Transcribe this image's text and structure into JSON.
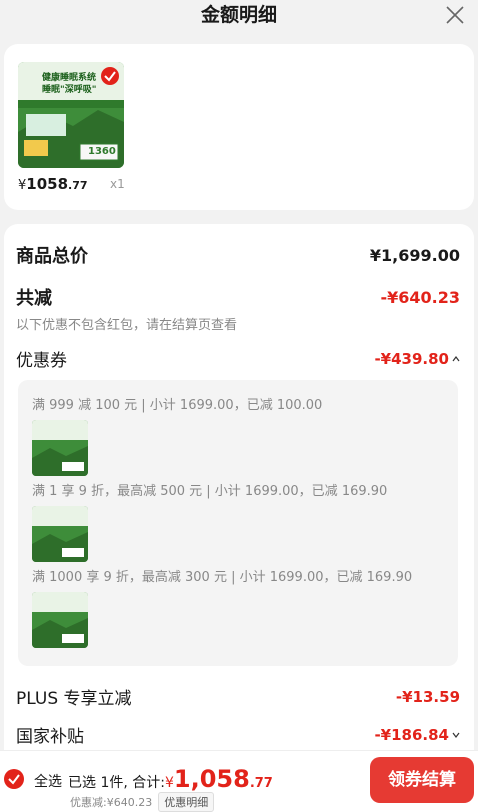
{
  "header": {
    "title": "金额明细"
  },
  "product": {
    "price_yen": "¥",
    "price_int": "1058",
    "price_dec": ".77",
    "qty": "x1",
    "thumb_text": {
      "line1": "健康睡眠系统",
      "line2": "睡眠\"深呼吸\"",
      "promo": "1360"
    }
  },
  "detail": {
    "total_label": "商品总价",
    "total_value": "¥1,699.00",
    "reduce_label": "共减",
    "reduce_value": "-¥640.23",
    "reduce_note": "以下优惠不包含红包，请在结算页查看",
    "coupon_label": "优惠券",
    "coupon_value": "-¥439.80",
    "coupon_items": [
      {
        "text": "满 999 减 100 元 | 小计 1699.00，已减 100.00"
      },
      {
        "text": "满 1 享 9 折，最高减 500 元 | 小计 1699.00，已减 169.90"
      },
      {
        "text": "满 1000 享 9 折，最高减 300 元 | 小计 1699.00，已减 169.90"
      }
    ],
    "plus_label": "PLUS 专享立减",
    "plus_value": "-¥13.59",
    "subsidy_label": "国家补贴",
    "subsidy_value": "-¥186.84"
  },
  "bottom": {
    "select_all": "全选",
    "summary_prefix": "已选 1件, 合计:",
    "total_yen": "¥",
    "total_int": "1,058",
    "total_dec": ".77",
    "saving": "优惠减:¥640.23",
    "saving_tag": "优惠明细",
    "pay_label": "领券结算"
  },
  "colors": {
    "accent": "#e2231a",
    "button": "#e63a33",
    "thumb_green": "#3e8d3a"
  },
  "icons": {
    "close": "close-icon",
    "checked": "check-circle-icon",
    "caret_up": "chevron-up-icon",
    "caret_down": "chevron-down-icon"
  }
}
